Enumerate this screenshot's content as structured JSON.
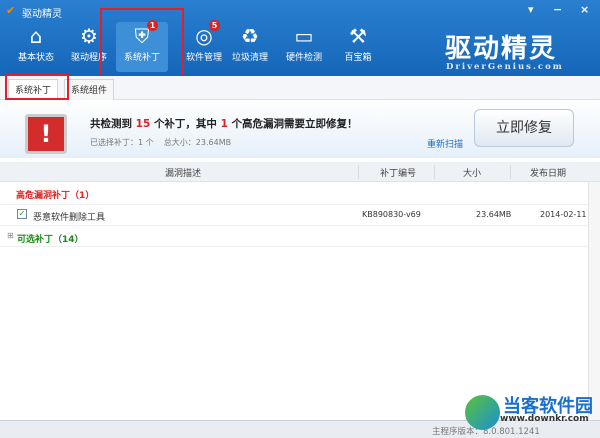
{
  "window": {
    "title": "驱动精灵",
    "menu_icon": "▾",
    "min_icon": "−",
    "close_icon": "×"
  },
  "toolbar": [
    {
      "label": "基本状态",
      "icon": "⌂"
    },
    {
      "label": "驱动程序",
      "icon": "⚙"
    },
    {
      "label": "系统补丁",
      "icon": "⛨",
      "badge": "1"
    },
    {
      "label": "软件管理",
      "icon": "◎",
      "badge": "5"
    },
    {
      "label": "垃圾清理",
      "icon": "♻"
    },
    {
      "label": "硬件检测",
      "icon": "▭"
    },
    {
      "label": "百宝箱",
      "icon": "⚒"
    }
  ],
  "brand": {
    "name": "驱动精灵",
    "site": "DriverGenius.com"
  },
  "tabs": [
    "系统补丁",
    "系统组件"
  ],
  "banner": {
    "prefix": "共检测到",
    "count": "15",
    "mid": "个补丁，其中",
    "high": "1",
    "suffix": "个高危漏洞需要立即修复！",
    "selected": "已选择补丁：1 个",
    "total": "总大小：23.64MB",
    "rescan": "重新扫描",
    "fix": "立即修复"
  },
  "table": {
    "headers": [
      "漏洞描述",
      "补丁编号",
      "大小",
      "发布日期"
    ],
    "group_high": "高危漏洞补丁（1）",
    "rows": [
      {
        "name": "恶意软件删除工具",
        "id": "KB890830-v69",
        "size": "23.64MB",
        "date": "2014-02-11",
        "checked": true
      }
    ],
    "group_optional": "可选补丁（14）"
  },
  "footer": {
    "version": "主程序版本：8.0.801.1241"
  },
  "watermark": {
    "name": "当客软件园",
    "url": "www.downkr.com"
  }
}
